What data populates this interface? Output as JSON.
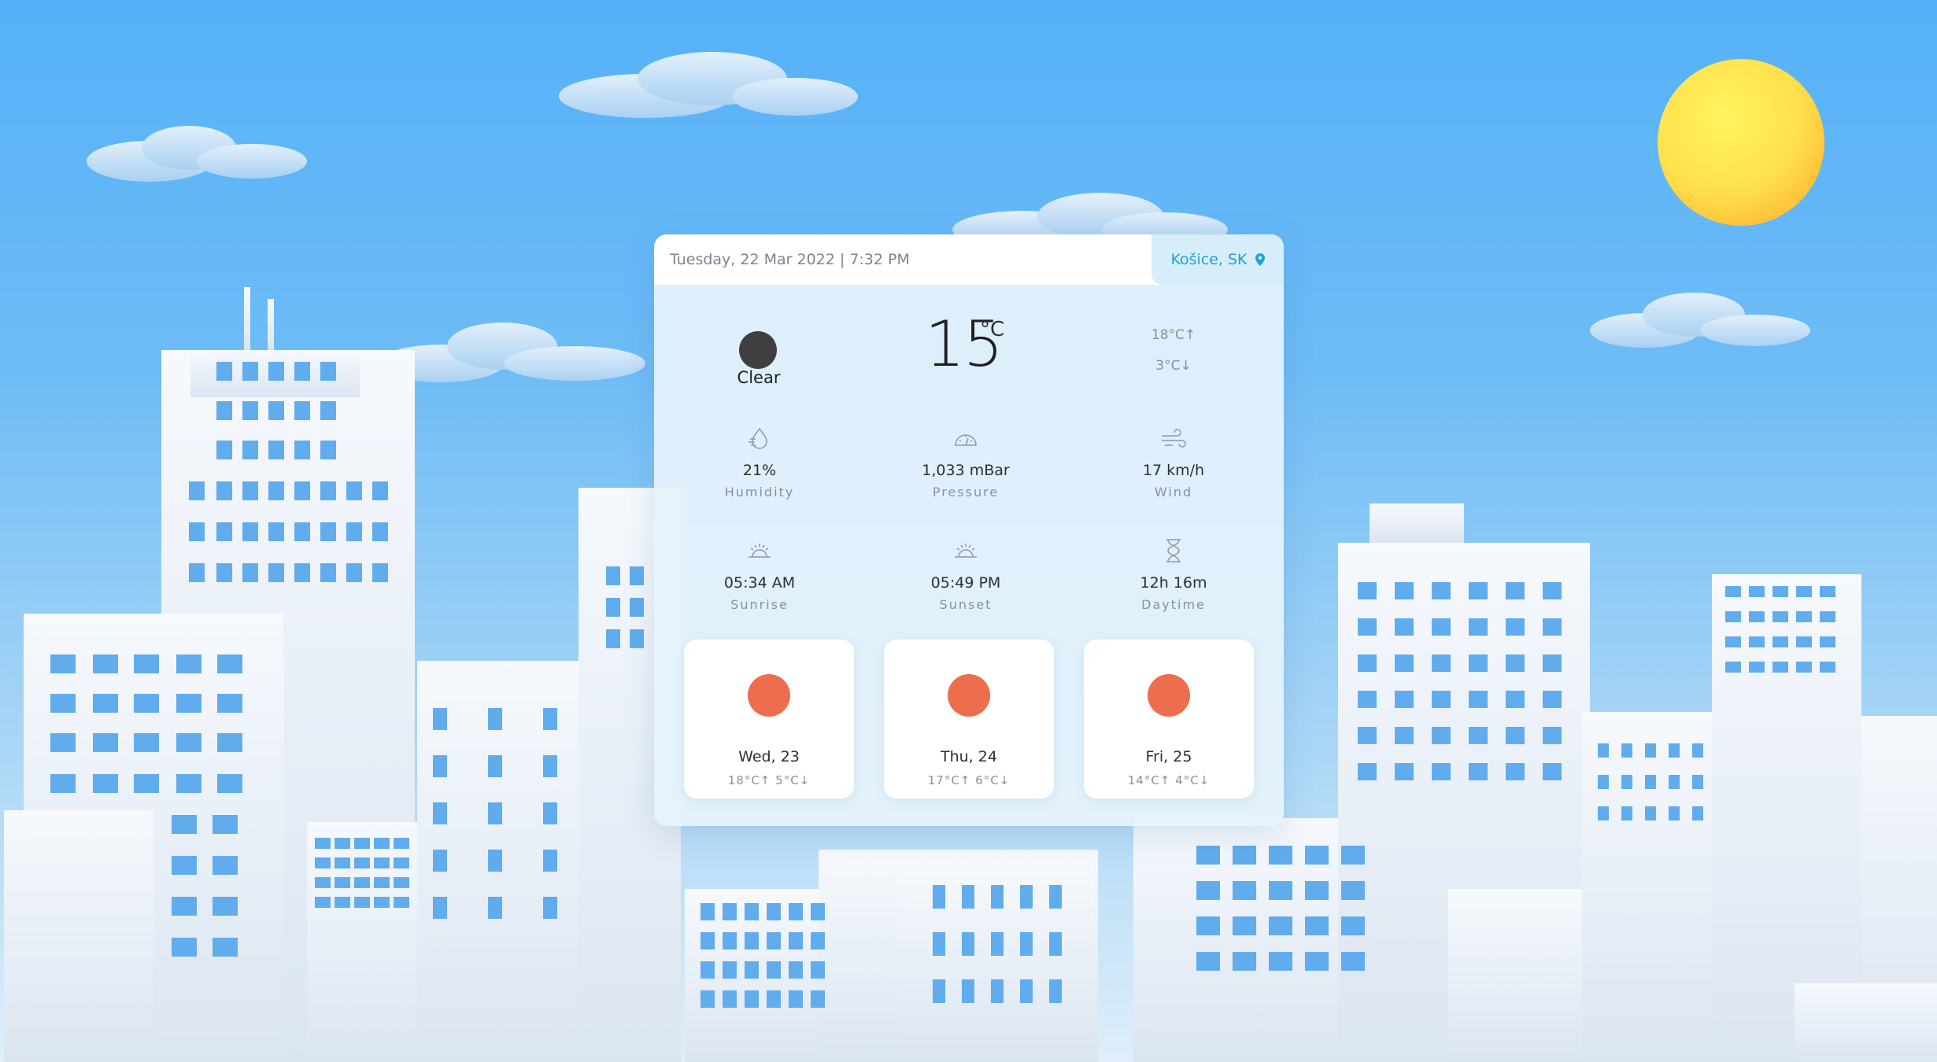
{
  "header": {
    "datetime": "Tuesday, 22 Mar 2022 | 7:32 PM",
    "location": "Košice, SK",
    "location_icon": "map-pin-icon"
  },
  "current": {
    "condition": "Clear",
    "condition_icon": "moon-icon",
    "temperature": "15",
    "unit": "°C",
    "high": "18°C↑",
    "low": "3°C↓"
  },
  "stats": [
    {
      "icon": "humidity-icon",
      "value": "21%",
      "label": "Humidity"
    },
    {
      "icon": "pressure-icon",
      "value": "1,033 mBar",
      "label": "Pressure"
    },
    {
      "icon": "wind-icon",
      "value": "17 km/h",
      "label": "Wind"
    },
    {
      "icon": "sunrise-icon",
      "value": "05:34 AM",
      "label": "Sunrise"
    },
    {
      "icon": "sunset-icon",
      "value": "05:49 PM",
      "label": "Sunset"
    },
    {
      "icon": "hourglass-icon",
      "value": "12h 16m",
      "label": "Daytime"
    }
  ],
  "forecast": [
    {
      "day": "Wed, 23",
      "range": "18°C↑ 5°C↓"
    },
    {
      "day": "Thu, 24",
      "range": "17°C↑ 6°C↓"
    },
    {
      "day": "Fri, 25",
      "range": "14°C↑ 4°C↓"
    }
  ],
  "colors": {
    "accent": "#1fa0d6",
    "forecast_icon": "#ec6e4c",
    "sun": "#ffd84a",
    "window": "#61acec"
  }
}
